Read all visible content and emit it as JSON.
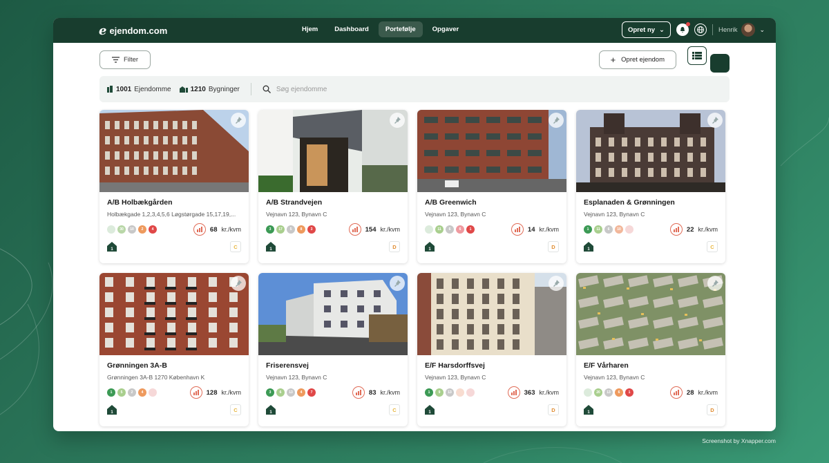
{
  "app": {
    "logo_text": "ejendom.com",
    "logo_mark": "e"
  },
  "nav": {
    "tabs": [
      {
        "label": "Hjem",
        "active": false
      },
      {
        "label": "Dashboard",
        "active": false
      },
      {
        "label": "Portefølje",
        "active": true
      },
      {
        "label": "Opgaver",
        "active": false
      }
    ]
  },
  "header": {
    "create_label": "Opret ny",
    "user_name": "Henrik",
    "icons": [
      "bell-icon",
      "globe-icon",
      "chevron-down-icon"
    ]
  },
  "toolbar": {
    "filter_label": "Filter",
    "create_property_label": "Opret ejendom"
  },
  "stats": {
    "properties_count": "1001",
    "properties_label": "Ejendomme",
    "buildings_count": "1210",
    "buildings_label": "Bygninger",
    "search_placeholder": "Søg ejendomme"
  },
  "unit_label": "kr./kvm",
  "properties": [
    {
      "title": "A/B Holbækgården",
      "address": "Holbækgade 1,2,3,4,5,6 Løgstørgade 15,17,19,...",
      "dots": [
        "",
        "30",
        "10",
        "2",
        "4"
      ],
      "dot_colors": [
        "#dcebdc",
        "#b9d7a8",
        "#c8c8c8",
        "#ee9a5e",
        "#e04848"
      ],
      "price": "68",
      "grade": "C",
      "photo": "brick-tall"
    },
    {
      "title": "A/B Strandvejen",
      "address": "Vejnavn 123, Bynavn C",
      "dots": [
        "3",
        "17",
        "5",
        "8",
        "3"
      ],
      "dot_colors": [
        "#3c9a55",
        "#a9cf8e",
        "#c8c8c8",
        "#ee9a5e",
        "#e04848"
      ],
      "price": "154",
      "grade": "D",
      "photo": "shopfront"
    },
    {
      "title": "A/B Greenwich",
      "address": "Vejnavn 123, Bynavn C",
      "dots": [
        "",
        "11",
        "6",
        "6",
        "1"
      ],
      "dot_colors": [
        "#dcebdc",
        "#a9cf8e",
        "#c8c8c8",
        "#ef9aa0",
        "#e04848"
      ],
      "price": "14",
      "grade": "D",
      "photo": "brick-balcony"
    },
    {
      "title": "Esplanaden & Grønningen",
      "address": "Vejnavn 123, Bynavn C",
      "dots": [
        "1",
        "11",
        "6",
        "10",
        ""
      ],
      "dot_colors": [
        "#3c9a55",
        "#a9cf8e",
        "#c8c8c8",
        "#f2b79a",
        "#f6d8d8"
      ],
      "price": "22",
      "grade": "C",
      "photo": "palace"
    },
    {
      "title": "Grønningen 3A-B",
      "address": "Grønningen 3A-B 1270 København K",
      "dots": [
        "1",
        "5",
        "2",
        "4",
        ""
      ],
      "dot_colors": [
        "#3c9a55",
        "#a9cf8e",
        "#c8c8c8",
        "#ee9a5e",
        "#f6d8d8"
      ],
      "price": "128",
      "grade": "C",
      "photo": "brick-red"
    },
    {
      "title": "Friserensvej",
      "address": "Vejnavn 123, Bynavn C",
      "dots": [
        "3",
        "6",
        "13",
        "4",
        "7"
      ],
      "dot_colors": [
        "#3c9a55",
        "#a9cf8e",
        "#c8c8c8",
        "#ee9a5e",
        "#e04848"
      ],
      "price": "83",
      "grade": "C",
      "photo": "white-block"
    },
    {
      "title": "E/F Harsdorffsvej",
      "address": "Vejnavn 123, Bynavn C",
      "dots": [
        "1",
        "9",
        "13",
        "",
        ""
      ],
      "dot_colors": [
        "#3c9a55",
        "#a9cf8e",
        "#c8c8c8",
        "#f8dcd0",
        "#f6d8d8"
      ],
      "price": "363",
      "grade": "D",
      "photo": "cream"
    },
    {
      "title": "E/F Vårharen",
      "address": "Vejnavn 123, Bynavn C",
      "dots": [
        "",
        "20",
        "13",
        "6",
        "1"
      ],
      "dot_colors": [
        "#dcebdc",
        "#a9cf8e",
        "#c8c8c8",
        "#ee9a5e",
        "#e04848"
      ],
      "price": "28",
      "grade": "D",
      "photo": "aerial"
    }
  ],
  "credit": "Screenshot by Xnapper.com"
}
